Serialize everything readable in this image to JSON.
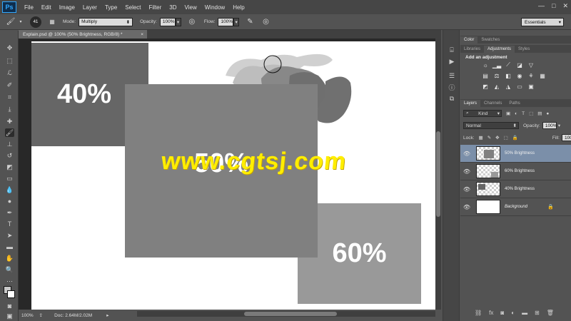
{
  "menu": {
    "logo": "Ps",
    "items": [
      "File",
      "Edit",
      "Image",
      "Layer",
      "Type",
      "Select",
      "Filter",
      "3D",
      "View",
      "Window",
      "Help"
    ],
    "window_controls": [
      "—",
      "□",
      "✕"
    ]
  },
  "options": {
    "brush_size": "41",
    "mode_label": "Mode:",
    "mode_value": "Multiply",
    "opacity_label": "Opacity:",
    "opacity_value": "100%",
    "flow_label": "Flow:",
    "flow_value": "100%",
    "workspace": "Essentials"
  },
  "document": {
    "tab_title": "Explain.psd @ 100% (50% Brightness, RGB/8) *",
    "close": "×"
  },
  "canvas": {
    "label_40": "40%",
    "label_50": "50%",
    "label_60": "60%",
    "watermark": "www.cgtsj.com"
  },
  "status": {
    "zoom": "100%",
    "doc": "Doc: 2.64M/2.02M"
  },
  "panels": {
    "color_tabs": [
      "Color",
      "Swatches"
    ],
    "adj_tabs": [
      "Libraries",
      "Adjustments",
      "Styles"
    ],
    "adjustments_title": "Add an adjustment",
    "layers_tabs": [
      "Layers",
      "Channels",
      "Paths"
    ],
    "kind_label": "Kind",
    "blend_mode": "Normal",
    "opacity_label": "Opacity:",
    "opacity_value": "100%",
    "lock_label": "Lock:",
    "fill_label": "Fill:",
    "fill_value": "100%",
    "layers": [
      {
        "name": "50% Brightness"
      },
      {
        "name": "60% Brightness"
      },
      {
        "name": "40% Brightness"
      },
      {
        "name": "Background"
      }
    ]
  },
  "colors": {
    "selected_layer": "#7b8fa9",
    "watermark": "#ffee00"
  }
}
